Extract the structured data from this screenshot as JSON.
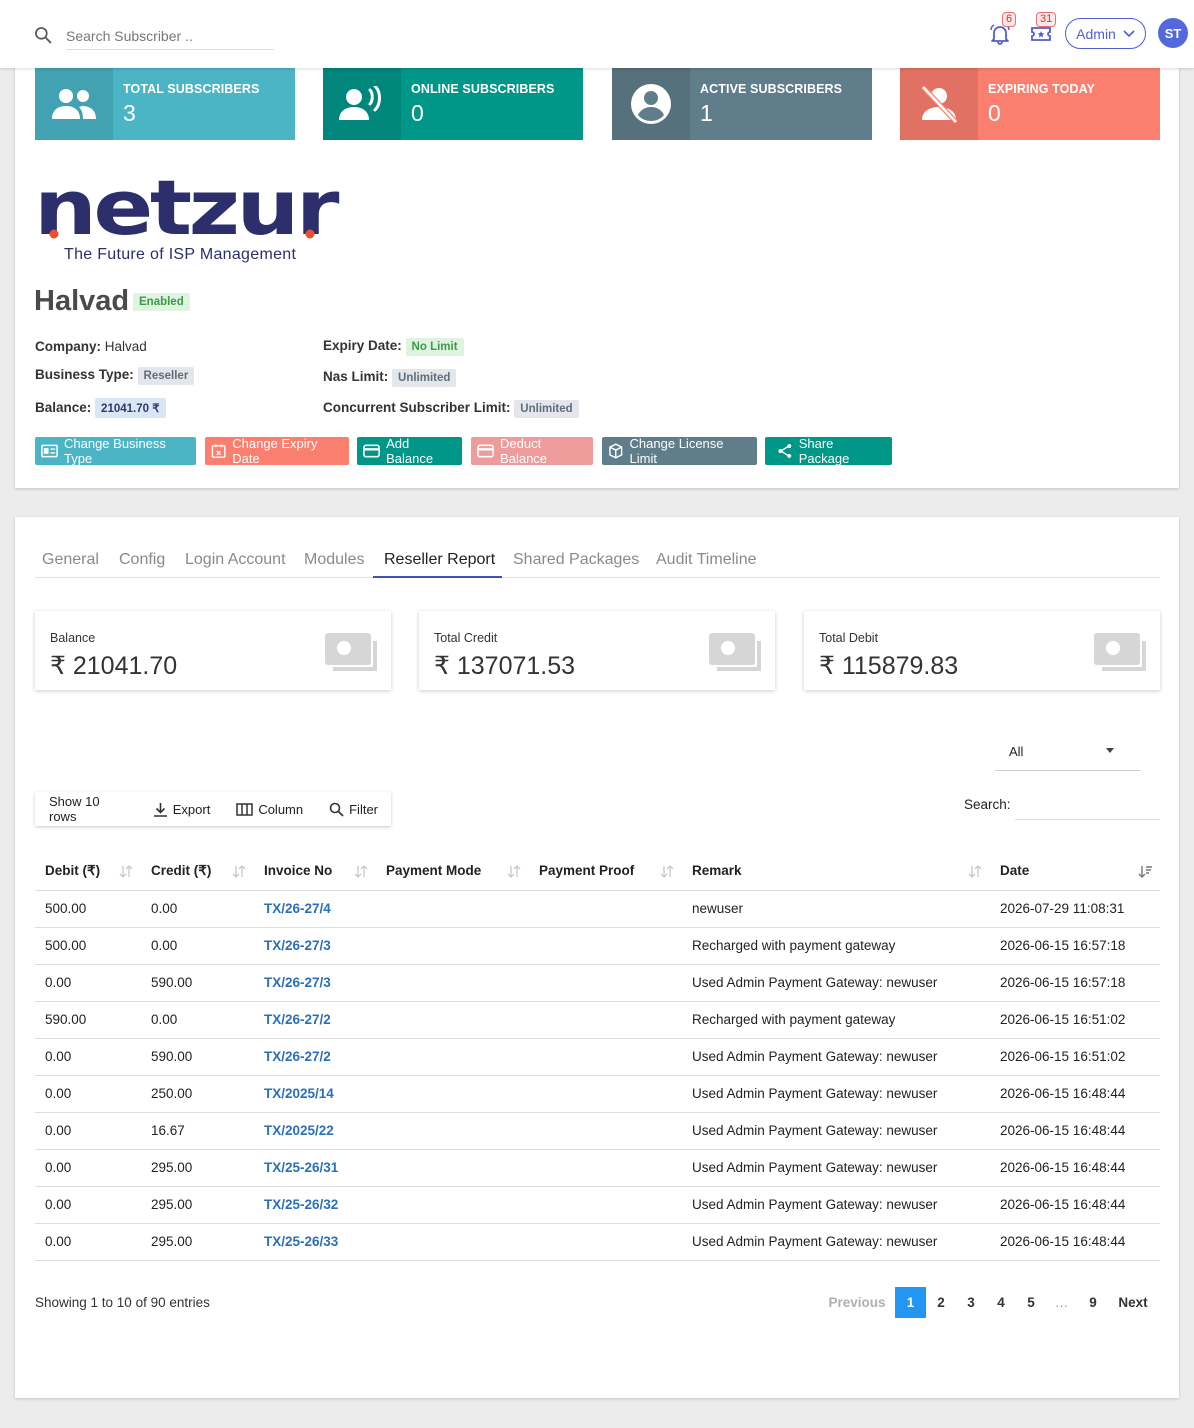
{
  "search": {
    "placeholder": "Search Subscriber .."
  },
  "notifications": {
    "bell_count": "6",
    "ticket_count": "31"
  },
  "user": {
    "role": "Admin",
    "initials": "ST"
  },
  "stats": [
    {
      "label": "TOTAL SUBSCRIBERS",
      "value": "3",
      "color": "#4bb5c6",
      "icon": "users-icon"
    },
    {
      "label": "ONLINE SUBSCRIBERS",
      "value": "0",
      "color": "#009688",
      "icon": "voice-icon"
    },
    {
      "label": "ACTIVE SUBSCRIBERS",
      "value": "1",
      "color": "#607d8b",
      "icon": "account-circle-icon"
    },
    {
      "label": "EXPIRING TODAY",
      "value": "0",
      "color": "#fb7f6f",
      "icon": "user-off-icon"
    }
  ],
  "brand": {
    "logo": "netzur",
    "tagline": "The Future of ISP Management"
  },
  "reseller": {
    "name": "Halvad",
    "status": "Enabled",
    "company_label": "Company:",
    "company": "Halvad",
    "business_type_label": "Business Type:",
    "business_type": "Reseller",
    "balance_label": "Balance:",
    "balance": "21041.70 ₹",
    "expiry_label": "Expiry Date:",
    "expiry": "No Limit",
    "nas_label": "Nas Limit:",
    "nas": "Unlimited",
    "concurrent_label": "Concurrent Subscriber Limit:",
    "concurrent": "Unlimited"
  },
  "actions": {
    "change_business_type": "Change Business Type",
    "change_expiry_date": "Change Expiry Date",
    "add_balance": "Add Balance",
    "deduct_balance": "Deduct Balance",
    "change_license_limit": "Change License Limit",
    "share_package": "Share Package"
  },
  "tabs": [
    "General",
    "Config",
    "Login Account",
    "Modules",
    "Reseller Report",
    "Shared Packages",
    "Audit Timeline"
  ],
  "active_tab": "Reseller Report",
  "summary": [
    {
      "label": "Balance",
      "value": "₹ 21041.70"
    },
    {
      "label": "Total Credit",
      "value": "₹ 137071.53"
    },
    {
      "label": "Total Debit",
      "value": "₹ 115879.83"
    }
  ],
  "filter": {
    "selected": "All"
  },
  "toolbar": {
    "show_rows": "Show 10 rows",
    "export": "Export",
    "column": "Column",
    "filter": "Filter"
  },
  "table_search_label": "Search:",
  "table": {
    "columns": [
      "Debit (₹)",
      "Credit (₹)",
      "Invoice No",
      "Payment Mode",
      "Payment Proof",
      "Remark",
      "Date"
    ],
    "rows": [
      [
        "500.00",
        "0.00",
        "TX/26-27/4",
        "",
        "",
        "newuser",
        "2026-07-29 11:08:31"
      ],
      [
        "500.00",
        "0.00",
        "TX/26-27/3",
        "",
        "",
        "Recharged with payment gateway",
        "2026-06-15 16:57:18"
      ],
      [
        "0.00",
        "590.00",
        "TX/26-27/3",
        "",
        "",
        "Used Admin Payment Gateway: newuser",
        "2026-06-15 16:57:18"
      ],
      [
        "590.00",
        "0.00",
        "TX/26-27/2",
        "",
        "",
        "Recharged with payment gateway",
        "2026-06-15 16:51:02"
      ],
      [
        "0.00",
        "590.00",
        "TX/26-27/2",
        "",
        "",
        "Used Admin Payment Gateway: newuser",
        "2026-06-15 16:51:02"
      ],
      [
        "0.00",
        "250.00",
        "TX/2025/14",
        "",
        "",
        "Used Admin Payment Gateway: newuser",
        "2026-06-15 16:48:44"
      ],
      [
        "0.00",
        "16.67",
        "TX/2025/22",
        "",
        "",
        "Used Admin Payment Gateway: newuser",
        "2026-06-15 16:48:44"
      ],
      [
        "0.00",
        "295.00",
        "TX/25-26/31",
        "",
        "",
        "Used Admin Payment Gateway: newuser",
        "2026-06-15 16:48:44"
      ],
      [
        "0.00",
        "295.00",
        "TX/25-26/32",
        "",
        "",
        "Used Admin Payment Gateway: newuser",
        "2026-06-15 16:48:44"
      ],
      [
        "0.00",
        "295.00",
        "TX/25-26/33",
        "",
        "",
        "Used Admin Payment Gateway: newuser",
        "2026-06-15 16:48:44"
      ]
    ]
  },
  "pagination": {
    "info": "Showing 1 to 10 of 90 entries",
    "previous": "Previous",
    "pages": [
      "1",
      "2",
      "3",
      "4",
      "5",
      "…",
      "9"
    ],
    "current": "1",
    "next": "Next"
  }
}
